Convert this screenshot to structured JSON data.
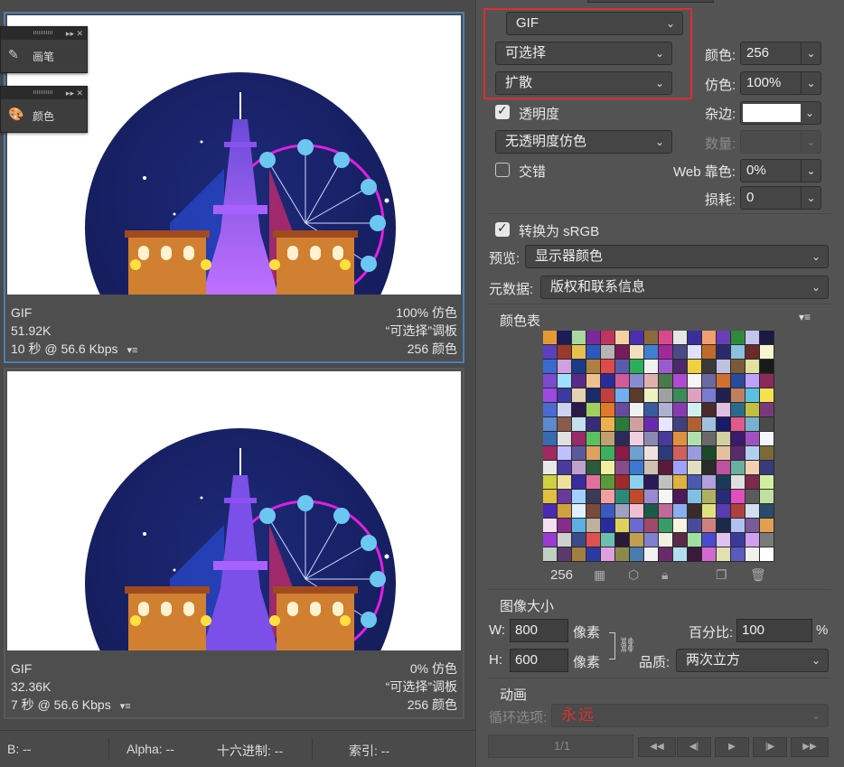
{
  "previews": [
    {
      "format": "GIF",
      "size": "51.92K",
      "time": "10 秒 @ 56.6 Kbps",
      "dither": "100% 仿色",
      "palette": "“可选择”调板",
      "colors": "256 颜色"
    },
    {
      "format": "GIF",
      "size": "32.36K",
      "time": "7 秒 @ 56.6 Kbps",
      "dither": "0% 仿色",
      "palette": "“可选择”调板",
      "colors": "256 颜色"
    }
  ],
  "float_panels": [
    {
      "label": "画笔",
      "icon": "brush-icon"
    },
    {
      "label": "颜色",
      "icon": "palette-icon"
    }
  ],
  "status_bar": {
    "b": "B: --",
    "alpha": "Alpha: --",
    "hex": "十六进制: --",
    "index": "索引: --"
  },
  "settings": {
    "format": "GIF",
    "reduction": "可选择",
    "dither_algo": "扩散",
    "colors_label": "颜色:",
    "colors_value": "256",
    "dither_label": "仿色:",
    "dither_value": "100%",
    "transparency_label": "透明度",
    "transparency_checked": true,
    "matte_label": "杂边:",
    "matte_color": "#ffffff",
    "trans_dither": "无透明度仿色",
    "amount_label": "数量:",
    "interlaced_label": "交错",
    "interlaced_checked": false,
    "web_snap_label": "Web 靠色:",
    "web_snap_value": "0%",
    "lossy_label": "损耗:",
    "lossy_value": "0",
    "srgb_label": "转换为 sRGB",
    "srgb_checked": true,
    "preview_label": "预览:",
    "preview_value": "显示器颜色",
    "metadata_label": "元数据:",
    "metadata_value": "版权和联系信息"
  },
  "color_table": {
    "title": "颜色表",
    "count": "256",
    "colors": [
      "#e39a35",
      "#1c1c59",
      "#a7d9a0",
      "#7a2a9a",
      "#c03560",
      "#f5d0a0",
      "#4a2fb0",
      "#8c6b3a",
      "#d84a8a",
      "#e5e5e5",
      "#3a2f9a",
      "#f0a070",
      "#6a3fb5",
      "#2f8a3a",
      "#c4c4f0",
      "#1a1a40",
      "#5a3fc0",
      "#9a3a2a",
      "#e8c050",
      "#2a5ac0",
      "#b5b5b5",
      "#7a1a5a",
      "#f0e0c0",
      "#3f7fd0",
      "#a02a9a",
      "#4a4a8a",
      "#e0e0ff",
      "#c06a2a",
      "#2a2a6a",
      "#8ac0e0",
      "#6a2a2a",
      "#f5f5d0",
      "#3a6ad0",
      "#d0a0e0",
      "#1a3a8a",
      "#b08040",
      "#e04a4a",
      "#5a5ab0",
      "#2ab05a",
      "#f0f0f0",
      "#9a5ad0",
      "#4a2a6a",
      "#f0d040",
      "#3a3a3a",
      "#c0c0e0",
      "#7a5a3a",
      "#e0e0a0",
      "#1a1a1a",
      "#7a4ad0",
      "#a0e0ff",
      "#5a2a8a",
      "#f0c090",
      "#2a2a9a",
      "#d05a9a",
      "#8a8ad0",
      "#e0b0b0",
      "#4a7a4a",
      "#b04ad0",
      "#f5f5f5",
      "#6a6aa0",
      "#d07030",
      "#2a4a9a",
      "#c0a0ff",
      "#8a2a5a",
      "#9a4ae0",
      "#3a3aa0",
      "#e5d0b0",
      "#1a2a6a",
      "#c04040",
      "#70b0f0",
      "#5a3a2a",
      "#f0f0c0",
      "#a0a0a0",
      "#3a8a5a",
      "#e0a0c0",
      "#7a7ad0",
      "#202050",
      "#c08060",
      "#5ac0e0",
      "#f5e050",
      "#4a6ad0",
      "#d0d0f0",
      "#2a1a4a",
      "#a0d060",
      "#e07a2a",
      "#6a4aa0",
      "#f0f0f0",
      "#3a5aa0",
      "#b0b0d0",
      "#8a3ab0",
      "#d0f0f0",
      "#4a2a2a",
      "#e0c0e0",
      "#2a6a8a",
      "#c0c040",
      "#7a3a7a",
      "#5a8ad0",
      "#8a5a4a",
      "#c0e0f0",
      "#3a2a7a",
      "#f0b050",
      "#2a7a3a",
      "#d0a0a0",
      "#6a2ab0",
      "#e5e5ff",
      "#404080",
      "#b06030",
      "#a0c0e0",
      "#1a1a6a",
      "#e05a8a",
      "#7ab0d0",
      "#4a4a4a",
      "#3a6ab0",
      "#e0e0e0",
      "#9a2a6a",
      "#5ac060",
      "#c0a070",
      "#2a2a5a",
      "#f0d0e0",
      "#8a8ab0",
      "#4a3a9a",
      "#e09040",
      "#b0e0b0",
      "#6a6a6a",
      "#d0d0a0",
      "#3a1a6a",
      "#a050c0",
      "#f5f5ff",
      "#a02a60",
      "#c0c0ff",
      "#5a5a9a",
      "#e0a060",
      "#3ab060",
      "#8a1a4a",
      "#70a0d0",
      "#f0e0e0",
      "#2a3a7a",
      "#d06060",
      "#9a9ae0",
      "#1a4a2a",
      "#e5c0a0",
      "#5a2a6a",
      "#b0d0f0",
      "#7a6a3a",
      "#e8e8e8",
      "#4a3aa0",
      "#c0a0d0",
      "#2a5a3a",
      "#f0f0a0",
      "#8a4a8a",
      "#3a7ad0",
      "#d0c0b0",
      "#5a1a3a",
      "#a0a0ff",
      "#e0e0c0",
      "#2a2a2a",
      "#c050a0",
      "#6ab0a0",
      "#f5d0b0",
      "#3a3a7a",
      "#d0d040",
      "#f0e0a0",
      "#3a2aa0",
      "#e070a0",
      "#5a9a3a",
      "#a02a2a",
      "#8ad0f0",
      "#2a1a5a",
      "#c0c0c0",
      "#e0b040",
      "#4a5ab0",
      "#b0a0e0",
      "#1a3a5a",
      "#e0e0e0",
      "#7a2a4a",
      "#d0f0a0",
      "#e0c040",
      "#6a3a9a",
      "#a0d0ff",
      "#3a3a5a",
      "#f0a0a0",
      "#2a8a7a",
      "#c04a2a",
      "#9a8ad0",
      "#f5f5f5",
      "#4a1a5a",
      "#80c0e0",
      "#b0b060",
      "#2a2a7a",
      "#e050c0",
      "#5a5a5a",
      "#c0e0a0",
      "#4a2ab0",
      "#d0a040",
      "#e0f0ff",
      "#7a4a3a",
      "#3a5ac0",
      "#a0a0c0",
      "#f0c0d0",
      "#1a5a4a",
      "#c06a9a",
      "#8ab0f0",
      "#3a2a2a",
      "#e0e080",
      "#5a3ab0",
      "#b04040",
      "#d0e0f0",
      "#2a4a6a",
      "#f0e0f0",
      "#8a2a8a",
      "#5ab0e0",
      "#c0b0a0",
      "#2a2aa0",
      "#e0d060",
      "#6a6ad0",
      "#a04a6a",
      "#3a9a6a",
      "#f5f5e0",
      "#4a4a9a",
      "#d08080",
      "#1a2a4a",
      "#b0c0f0",
      "#7a5a9a",
      "#e0a050",
      "#9a3ad0",
      "#d0d0d0",
      "#3a4a8a",
      "#e05050",
      "#6ac0b0",
      "#2a1a3a",
      "#c0a050",
      "#8080d0",
      "#f0f0e0",
      "#5a2a4a",
      "#a0e0a0",
      "#4a4ad0",
      "#e0c0f0",
      "#3a3a9a",
      "#d0a0f0",
      "#7a7a7a",
      "#c0d0c0",
      "#5a3a6a",
      "#a08040",
      "#2a3aa0",
      "#e0a0e0",
      "#8a8a4a",
      "#4a7ab0",
      "#f0f0f0",
      "#6a2a6a",
      "#b0e0f0",
      "#3a1a3a",
      "#d06ad0",
      "#e0e0b0",
      "#5a5ac0",
      "#f0f0f0",
      "#ffffff"
    ]
  },
  "image_size": {
    "title": "图像大小",
    "w_label": "W:",
    "w_value": "800",
    "h_label": "H:",
    "h_value": "600",
    "unit": "像素",
    "percent_label": "百分比:",
    "percent_value": "100",
    "percent_sign": "%",
    "quality_label": "品质:",
    "quality_value": "两次立方"
  },
  "animation": {
    "title": "动画",
    "loop_label": "循环选项:",
    "loop_value": "永远",
    "frame": "1/1"
  },
  "colors": {
    "highlight": "#d9302f",
    "selected_border": "#4a7fb5"
  }
}
